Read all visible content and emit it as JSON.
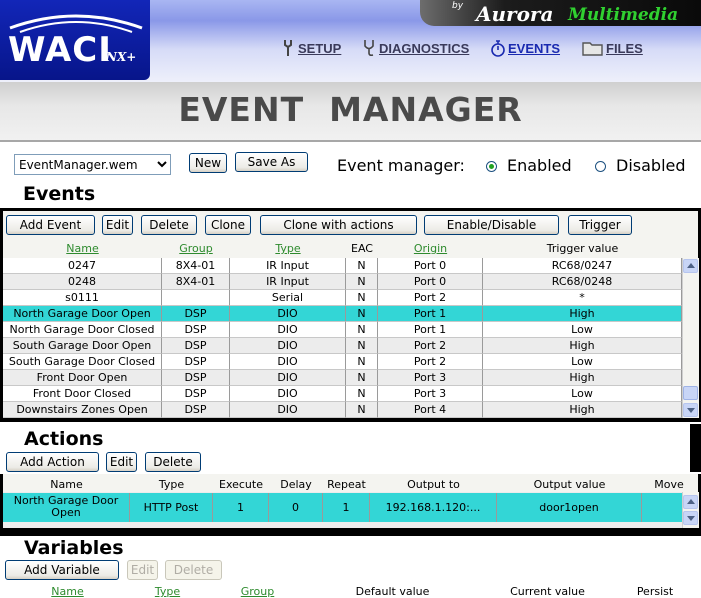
{
  "header": {
    "logo_text": "WACI",
    "logo_sub": "NX+",
    "brand_by": "by",
    "brand_name": "Aurora",
    "brand_multimedia": "Multimedia",
    "nav": [
      {
        "label": "SETUP",
        "icon": "wrench-icon"
      },
      {
        "label": "DIAGNOSTICS",
        "icon": "stethoscope-icon"
      },
      {
        "label": "EVENTS",
        "icon": "stopwatch-icon",
        "active": true
      },
      {
        "label": "FILES",
        "icon": "folder-icon"
      }
    ]
  },
  "page_title": "EVENT  MANAGER",
  "file_select": {
    "value": "EventManager.wem"
  },
  "toolbar": {
    "new_label": "New",
    "save_as_label": "Save As"
  },
  "event_manager": {
    "label": "Event manager:",
    "enabled_label": "Enabled",
    "disabled_label": "Disabled",
    "state": "Enabled"
  },
  "events": {
    "title": "Events",
    "buttons": {
      "add": "Add Event",
      "edit": "Edit",
      "delete": "Delete",
      "clone": "Clone",
      "clone_actions": "Clone with actions",
      "enable_disable": "Enable/Disable",
      "trigger": "Trigger"
    },
    "columns": [
      "Name",
      "Group",
      "Type",
      "EAC",
      "Origin",
      "Trigger value"
    ],
    "rows": [
      [
        "0247",
        "8X4-01",
        "IR Input",
        "N",
        "Port 0",
        "RC68/0247"
      ],
      [
        "0248",
        "8X4-01",
        "IR Input",
        "N",
        "Port 0",
        "RC68/0248"
      ],
      [
        "s0111",
        "",
        "Serial",
        "N",
        "Port 2",
        "*"
      ],
      [
        "North Garage Door Open",
        "DSP",
        "DIO",
        "N",
        "Port 1",
        "High"
      ],
      [
        "North Garage Door Closed",
        "DSP",
        "DIO",
        "N",
        "Port 1",
        "Low"
      ],
      [
        "South Garage Door Open",
        "DSP",
        "DIO",
        "N",
        "Port 2",
        "High"
      ],
      [
        "South Garage Door Closed",
        "DSP",
        "DIO",
        "N",
        "Port 2",
        "Low"
      ],
      [
        "Front Door Open",
        "DSP",
        "DIO",
        "N",
        "Port 3",
        "High"
      ],
      [
        "Front Door Closed",
        "DSP",
        "DIO",
        "N",
        "Port 3",
        "Low"
      ],
      [
        "Downstairs Zones Open",
        "DSP",
        "DIO",
        "N",
        "Port 4",
        "High"
      ]
    ],
    "selected_row": 3
  },
  "actions": {
    "title": "Actions",
    "buttons": {
      "add": "Add Action",
      "edit": "Edit",
      "delete": "Delete"
    },
    "columns": [
      "Name",
      "Type",
      "Execute",
      "Delay",
      "Repeat",
      "Output to",
      "Output value",
      "Move"
    ],
    "rows": [
      [
        "North Garage Door Open",
        "HTTP Post",
        "1",
        "0",
        "1",
        "192.168.1.120:...",
        "door1open",
        ""
      ]
    ]
  },
  "variables": {
    "title": "Variables",
    "buttons": {
      "add": "Add Variable",
      "edit": "Edit",
      "delete": "Delete"
    },
    "columns": [
      "Name",
      "Type",
      "Group",
      "Default value",
      "Current value",
      "Persist"
    ]
  },
  "colors": {
    "selected_row": "#33d6d6",
    "header_link": "#2e8b2e",
    "logo_blue": "#07158a"
  }
}
